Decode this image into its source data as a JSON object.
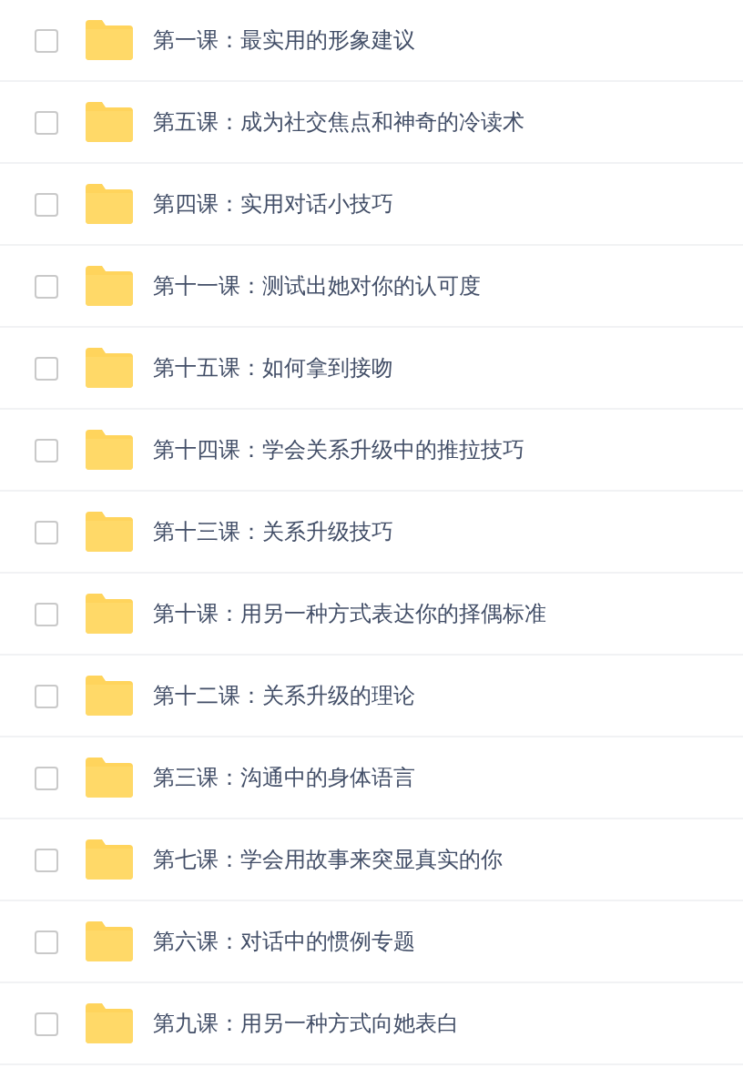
{
  "files": [
    {
      "name": "第一课：最实用的形象建议",
      "checked": false
    },
    {
      "name": "第五课：成为社交焦点和神奇的冷读术",
      "checked": false
    },
    {
      "name": "第四课：实用对话小技巧",
      "checked": false
    },
    {
      "name": "第十一课：测试出她对你的认可度",
      "checked": false
    },
    {
      "name": "第十五课：如何拿到接吻",
      "checked": false
    },
    {
      "name": "第十四课：学会关系升级中的推拉技巧",
      "checked": false
    },
    {
      "name": "第十三课：关系升级技巧",
      "checked": false
    },
    {
      "name": "第十课：用另一种方式表达你的择偶标准",
      "checked": false
    },
    {
      "name": "第十二课：关系升级的理论",
      "checked": false
    },
    {
      "name": "第三课：沟通中的身体语言",
      "checked": false
    },
    {
      "name": "第七课：学会用故事来突显真实的你",
      "checked": false
    },
    {
      "name": "第六课：对话中的惯例专题",
      "checked": false
    },
    {
      "name": "第九课：用另一种方式向她表白",
      "checked": false
    }
  ]
}
